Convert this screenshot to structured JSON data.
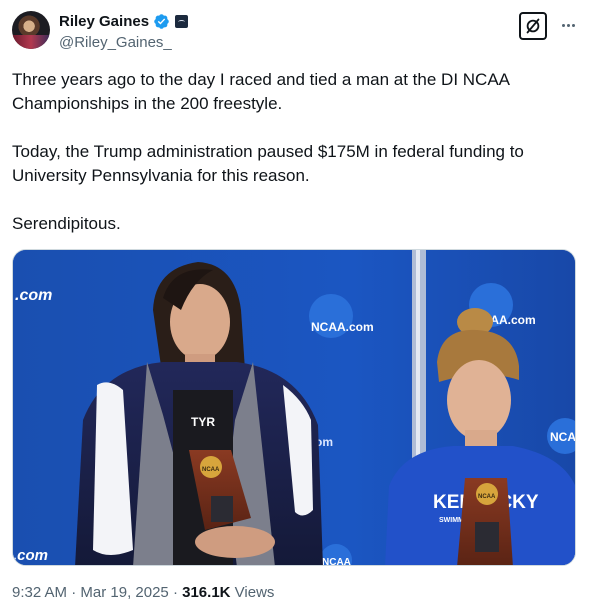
{
  "author": {
    "display_name": "Riley Gaines",
    "handle": "@Riley_Gaines_"
  },
  "tweet": {
    "paragraphs": [
      "Three years ago to the day I raced and tied a man at the DI NCAA Championships in the 200 freestyle.",
      "Today, the Trump administration paused $175M in federal funding to University Pennsylvania for this reason.",
      "Serendipitous."
    ]
  },
  "media": {
    "banner_texts": {
      "left_com": ".com",
      "ncaa_logo_center": "NCAA.com",
      "ncaa_logo_right": "NCAA.com",
      "ncaa_right_edge": "NCA",
      "bottom_left_com": ".com",
      "mid_com": ".com",
      "bottom_mid": "NCAA"
    },
    "apparel_texts": {
      "tyr_logo": "TYR",
      "kentucky": "KENTUCKY",
      "swimming": "SWIMMING · DIVING",
      "trophy_badge": "NCAA"
    }
  },
  "meta": {
    "time": "9:32 AM",
    "separator": " · ",
    "date": "Mar 19, 2025",
    "views_count": "316.1K",
    "views_label": " Views"
  },
  "colors": {
    "banner_blue": "#1a52b8",
    "ncaa_logo_blue": "#2a6fd9",
    "verified_blue": "#1d9bf0",
    "text_secondary": "#536471"
  },
  "icons": {
    "verified": "verified-badge-icon",
    "affiliate": "affiliate-badge-icon",
    "grok": "grok-icon",
    "more": "more-dots-icon"
  }
}
